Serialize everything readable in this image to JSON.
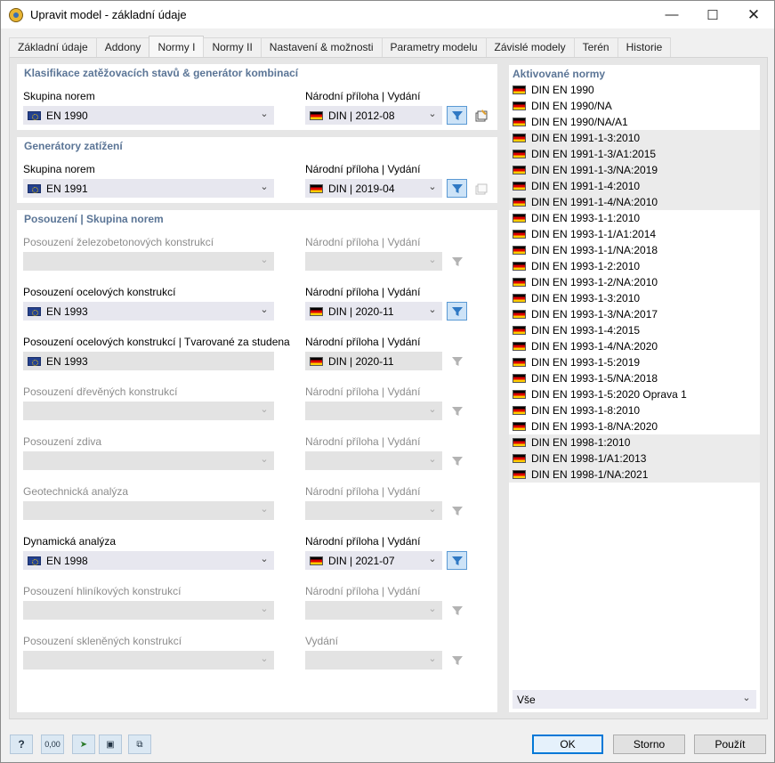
{
  "window": {
    "title": "Upravit model - základní údaje"
  },
  "tabs": [
    {
      "label": "Základní údaje"
    },
    {
      "label": "Addony"
    },
    {
      "label": "Normy I"
    },
    {
      "label": "Normy II"
    },
    {
      "label": "Nastavení & možnosti"
    },
    {
      "label": "Parametry modelu"
    },
    {
      "label": "Závislé modely"
    },
    {
      "label": "Terén"
    },
    {
      "label": "Historie"
    }
  ],
  "sec1": {
    "title": "Klasifikace zatěžovacích stavů & generátor kombinací",
    "group_label": "Skupina norem",
    "group_value": "EN 1990",
    "annex_label": "Národní příloha | Vydání",
    "annex_value": "DIN | 2012-08"
  },
  "sec2": {
    "title": "Generátory zatížení",
    "group_label": "Skupina norem",
    "group_value": "EN 1991",
    "annex_label": "Národní příloha | Vydání",
    "annex_value": "DIN | 2019-04"
  },
  "sec3": {
    "title": "Posouzení | Skupina norem",
    "rows": [
      {
        "label": "Posouzení železobetonových konstrukcí",
        "value": "",
        "annex_label": "Národní příloha | Vydání",
        "annex_value": "",
        "enabled": false
      },
      {
        "label": "Posouzení ocelových konstrukcí",
        "value": "EN 1993",
        "annex_label": "Národní příloha | Vydání",
        "annex_value": "DIN | 2020-11",
        "enabled": true
      },
      {
        "label": "Posouzení ocelových konstrukcí | Tvarované za studena",
        "value": "EN 1993",
        "annex_label": "Národní příloha | Vydání",
        "annex_value": "DIN | 2020-11",
        "enabled": true,
        "readonly": true
      },
      {
        "label": "Posouzení dřevěných konstrukcí",
        "value": "",
        "annex_label": "Národní příloha | Vydání",
        "annex_value": "",
        "enabled": false
      },
      {
        "label": "Posouzení zdiva",
        "value": "",
        "annex_label": "Národní příloha | Vydání",
        "annex_value": "",
        "enabled": false
      },
      {
        "label": "Geotechnická analýza",
        "value": "",
        "annex_label": "Národní příloha | Vydání",
        "annex_value": "",
        "enabled": false
      },
      {
        "label": "Dynamická analýza",
        "value": "EN 1998",
        "annex_label": "Národní příloha | Vydání",
        "annex_value": "DIN | 2021-07",
        "enabled": true
      },
      {
        "label": "Posouzení hliníkových konstrukcí",
        "value": "",
        "annex_label": "Národní příloha | Vydání",
        "annex_value": "",
        "enabled": false
      },
      {
        "label": "Posouzení skleněných konstrukcí",
        "value": "",
        "annex_label": "Vydání",
        "annex_value": "",
        "enabled": false
      }
    ]
  },
  "norms": {
    "title": "Aktivované normy",
    "filter_value": "Vše",
    "items": [
      "DIN EN 1990",
      "DIN EN 1990/NA",
      "DIN EN 1990/NA/A1",
      "DIN EN 1991-1-3:2010",
      "DIN EN 1991-1-3/A1:2015",
      "DIN EN 1991-1-3/NA:2019",
      "DIN EN 1991-1-4:2010",
      "DIN EN 1991-1-4/NA:2010",
      "DIN EN 1993-1-1:2010",
      "DIN EN 1993-1-1/A1:2014",
      "DIN EN 1993-1-1/NA:2018",
      "DIN EN 1993-1-2:2010",
      "DIN EN 1993-1-2/NA:2010",
      "DIN EN 1993-1-3:2010",
      "DIN EN 1993-1-3/NA:2017",
      "DIN EN 1993-1-4:2015",
      "DIN EN 1993-1-4/NA:2020",
      "DIN EN 1993-1-5:2019",
      "DIN EN 1993-1-5/NA:2018",
      "DIN EN 1993-1-5:2020 Oprava 1",
      "DIN EN 1993-1-8:2010",
      "DIN EN 1993-1-8/NA:2020",
      "DIN EN 1998-1:2010",
      "DIN EN 1998-1/A1:2013",
      "DIN EN 1998-1/NA:2021"
    ]
  },
  "footer": {
    "ok": "OK",
    "cancel": "Storno",
    "apply": "Použít",
    "units_icon_text": "0,00"
  }
}
